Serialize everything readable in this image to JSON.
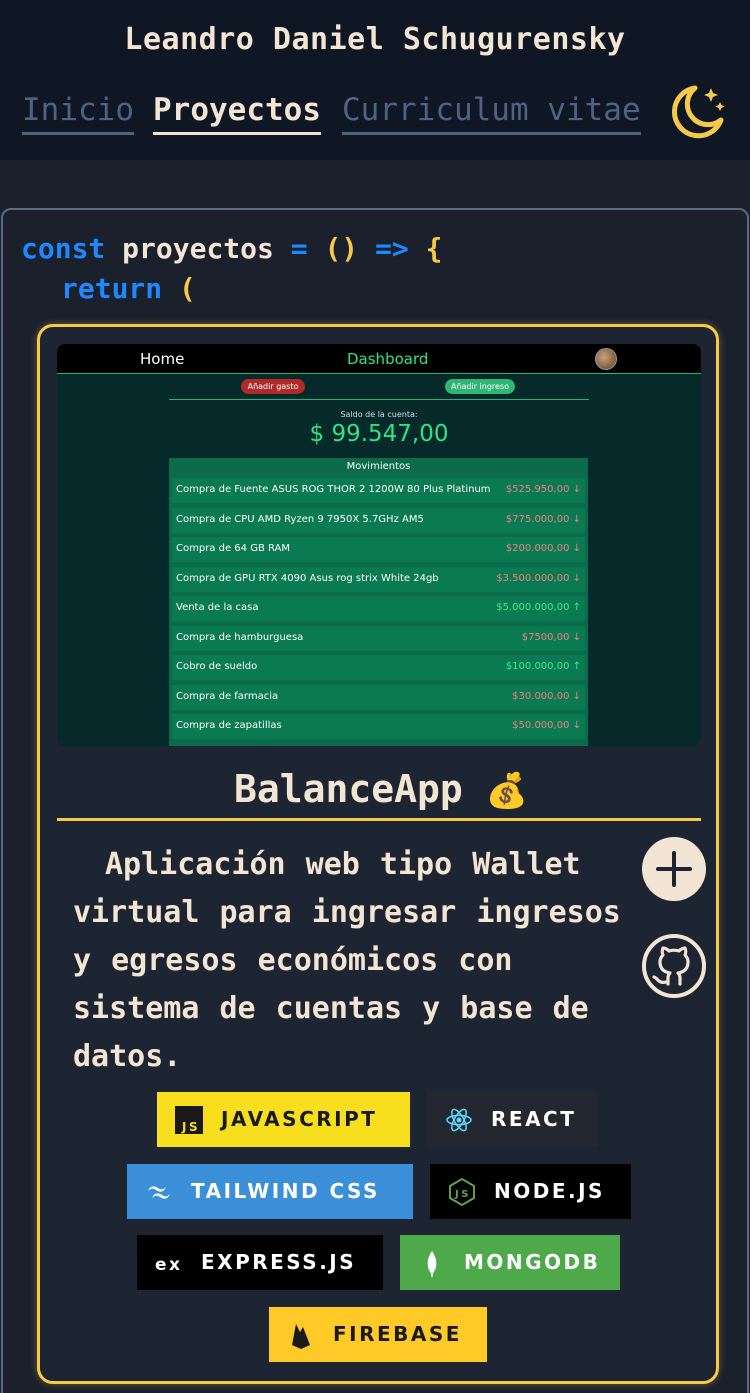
{
  "header": {
    "title": "Leandro Daniel Schugurensky",
    "nav": [
      "Inicio",
      "Proyectos",
      "Curriculum vitae"
    ],
    "theme_icon": "moon-stars-icon"
  },
  "code": {
    "kw_const": "const",
    "name": "proyectos",
    "eq": "=",
    "parens": "()",
    "arrow": "=>",
    "brace": "{",
    "kw_return": "return",
    "open_paren": "("
  },
  "project": {
    "title": "BalanceApp",
    "emoji": "💰",
    "description": "Aplicación web tipo Wallet virtual para ingresar ingresos y egresos económicos con sistema de cuentas y base de datos.",
    "add_icon": "plus-icon",
    "github_icon": "github-icon",
    "preview": {
      "nav_home": "Home",
      "nav_dashboard": "Dashboard",
      "btn_gasto": "Añadir gasto",
      "btn_ingreso": "Añadir ingreso",
      "saldo_label": "Saldo de la cuenta:",
      "saldo_value": "$ 99.547,00",
      "list_title": "Movimientos",
      "movements": [
        {
          "label": "Compra de Fuente ASUS ROG THOR 2 1200W 80 Plus Platinum",
          "amount": "$525.950,00 ↓",
          "type": "neg"
        },
        {
          "label": "Compra de CPU AMD Ryzen 9 7950X 5.7GHz AM5",
          "amount": "$775.000,00 ↓",
          "type": "neg"
        },
        {
          "label": "Compra de 64 GB RAM",
          "amount": "$200.000,00 ↓",
          "type": "neg"
        },
        {
          "label": "Compra de GPU RTX 4090 Asus rog strix White 24gb",
          "amount": "$3.500.000,00 ↓",
          "type": "neg"
        },
        {
          "label": "Venta de la casa",
          "amount": "$5.000.000,00 ↑",
          "type": "pos"
        },
        {
          "label": "Compra de hamburguesa",
          "amount": "$7500,00 ↓",
          "type": "neg"
        },
        {
          "label": "Cobro de sueldo",
          "amount": "$100.000,00 ↑",
          "type": "pos"
        },
        {
          "label": "Compra de farmacia",
          "amount": "$30.000,00 ↓",
          "type": "neg"
        },
        {
          "label": "Compra de zapatillas",
          "amount": "$50.000,00 ↓",
          "type": "neg"
        }
      ]
    },
    "tech": [
      {
        "label": "JAVASCRIPT",
        "icon": "javascript-icon",
        "bg": "#f7df1e",
        "fg": "#1a1a1a"
      },
      {
        "label": "REACT",
        "icon": "react-icon",
        "bg": "#23272f",
        "fg": "#ffffff"
      },
      {
        "label": "TAILWIND CSS",
        "icon": "tailwind-icon",
        "bg": "#3b8fd9",
        "fg": "#ffffff"
      },
      {
        "label": "NODE.JS",
        "icon": "nodejs-icon",
        "bg": "#000000",
        "fg": "#ffffff"
      },
      {
        "label": "EXPRESS.JS",
        "icon": "express-icon",
        "bg": "#000000",
        "fg": "#ffffff"
      },
      {
        "label": "MONGODB",
        "icon": "mongodb-icon",
        "bg": "#4ea94b",
        "fg": "#ffffff"
      },
      {
        "label": "FIREBASE",
        "icon": "firebase-icon",
        "bg": "#ffca28",
        "fg": "#1a1a1a"
      }
    ]
  },
  "colors": {
    "accent": "#f7c948",
    "background": "#1a202c",
    "header_bg": "#0f1624",
    "text": "#f3e5d4",
    "keyword": "#1e88ff"
  }
}
